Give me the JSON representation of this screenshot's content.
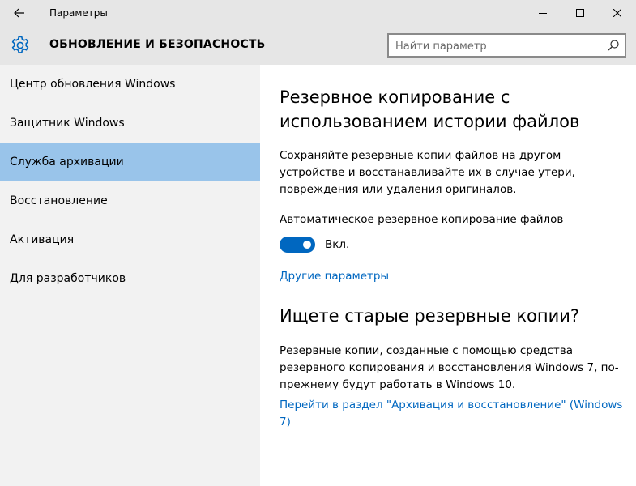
{
  "window": {
    "title": "Параметры"
  },
  "header": {
    "title": "ОБНОВЛЕНИЕ И БЕЗОПАСНОСТЬ",
    "search_placeholder": "Найти параметр"
  },
  "sidebar": {
    "items": [
      {
        "label": "Центр обновления Windows",
        "active": false
      },
      {
        "label": "Защитник Windows",
        "active": false
      },
      {
        "label": "Служба архивации",
        "active": true
      },
      {
        "label": "Восстановление",
        "active": false
      },
      {
        "label": "Активация",
        "active": false
      },
      {
        "label": "Для разработчиков",
        "active": false
      }
    ]
  },
  "main": {
    "heading": "Резервное копирование с использованием истории файлов",
    "description": "Сохраняйте резервные копии файлов на другом устройстве и восстанавливайте их в случае утери, повреждения или удаления оригиналов.",
    "auto_backup_label": "Автоматическое резервное копирование файлов",
    "toggle_state": "Вкл.",
    "more_options_link": "Другие параметры",
    "old_backups_heading": "Ищете старые резервные копии?",
    "old_backups_text": "Резервные копии, созданные с помощью средства резервного копирования и восстановления Windows 7, по-прежнему будут работать в Windows 10.",
    "old_backups_link": "Перейти в раздел \"Архивация и восстановление\" (Windows 7)"
  },
  "colors": {
    "accent": "#0067c0",
    "active_nav": "#99c4ea",
    "chrome": "#e6e6e6",
    "sidebar_bg": "#f2f2f2"
  }
}
